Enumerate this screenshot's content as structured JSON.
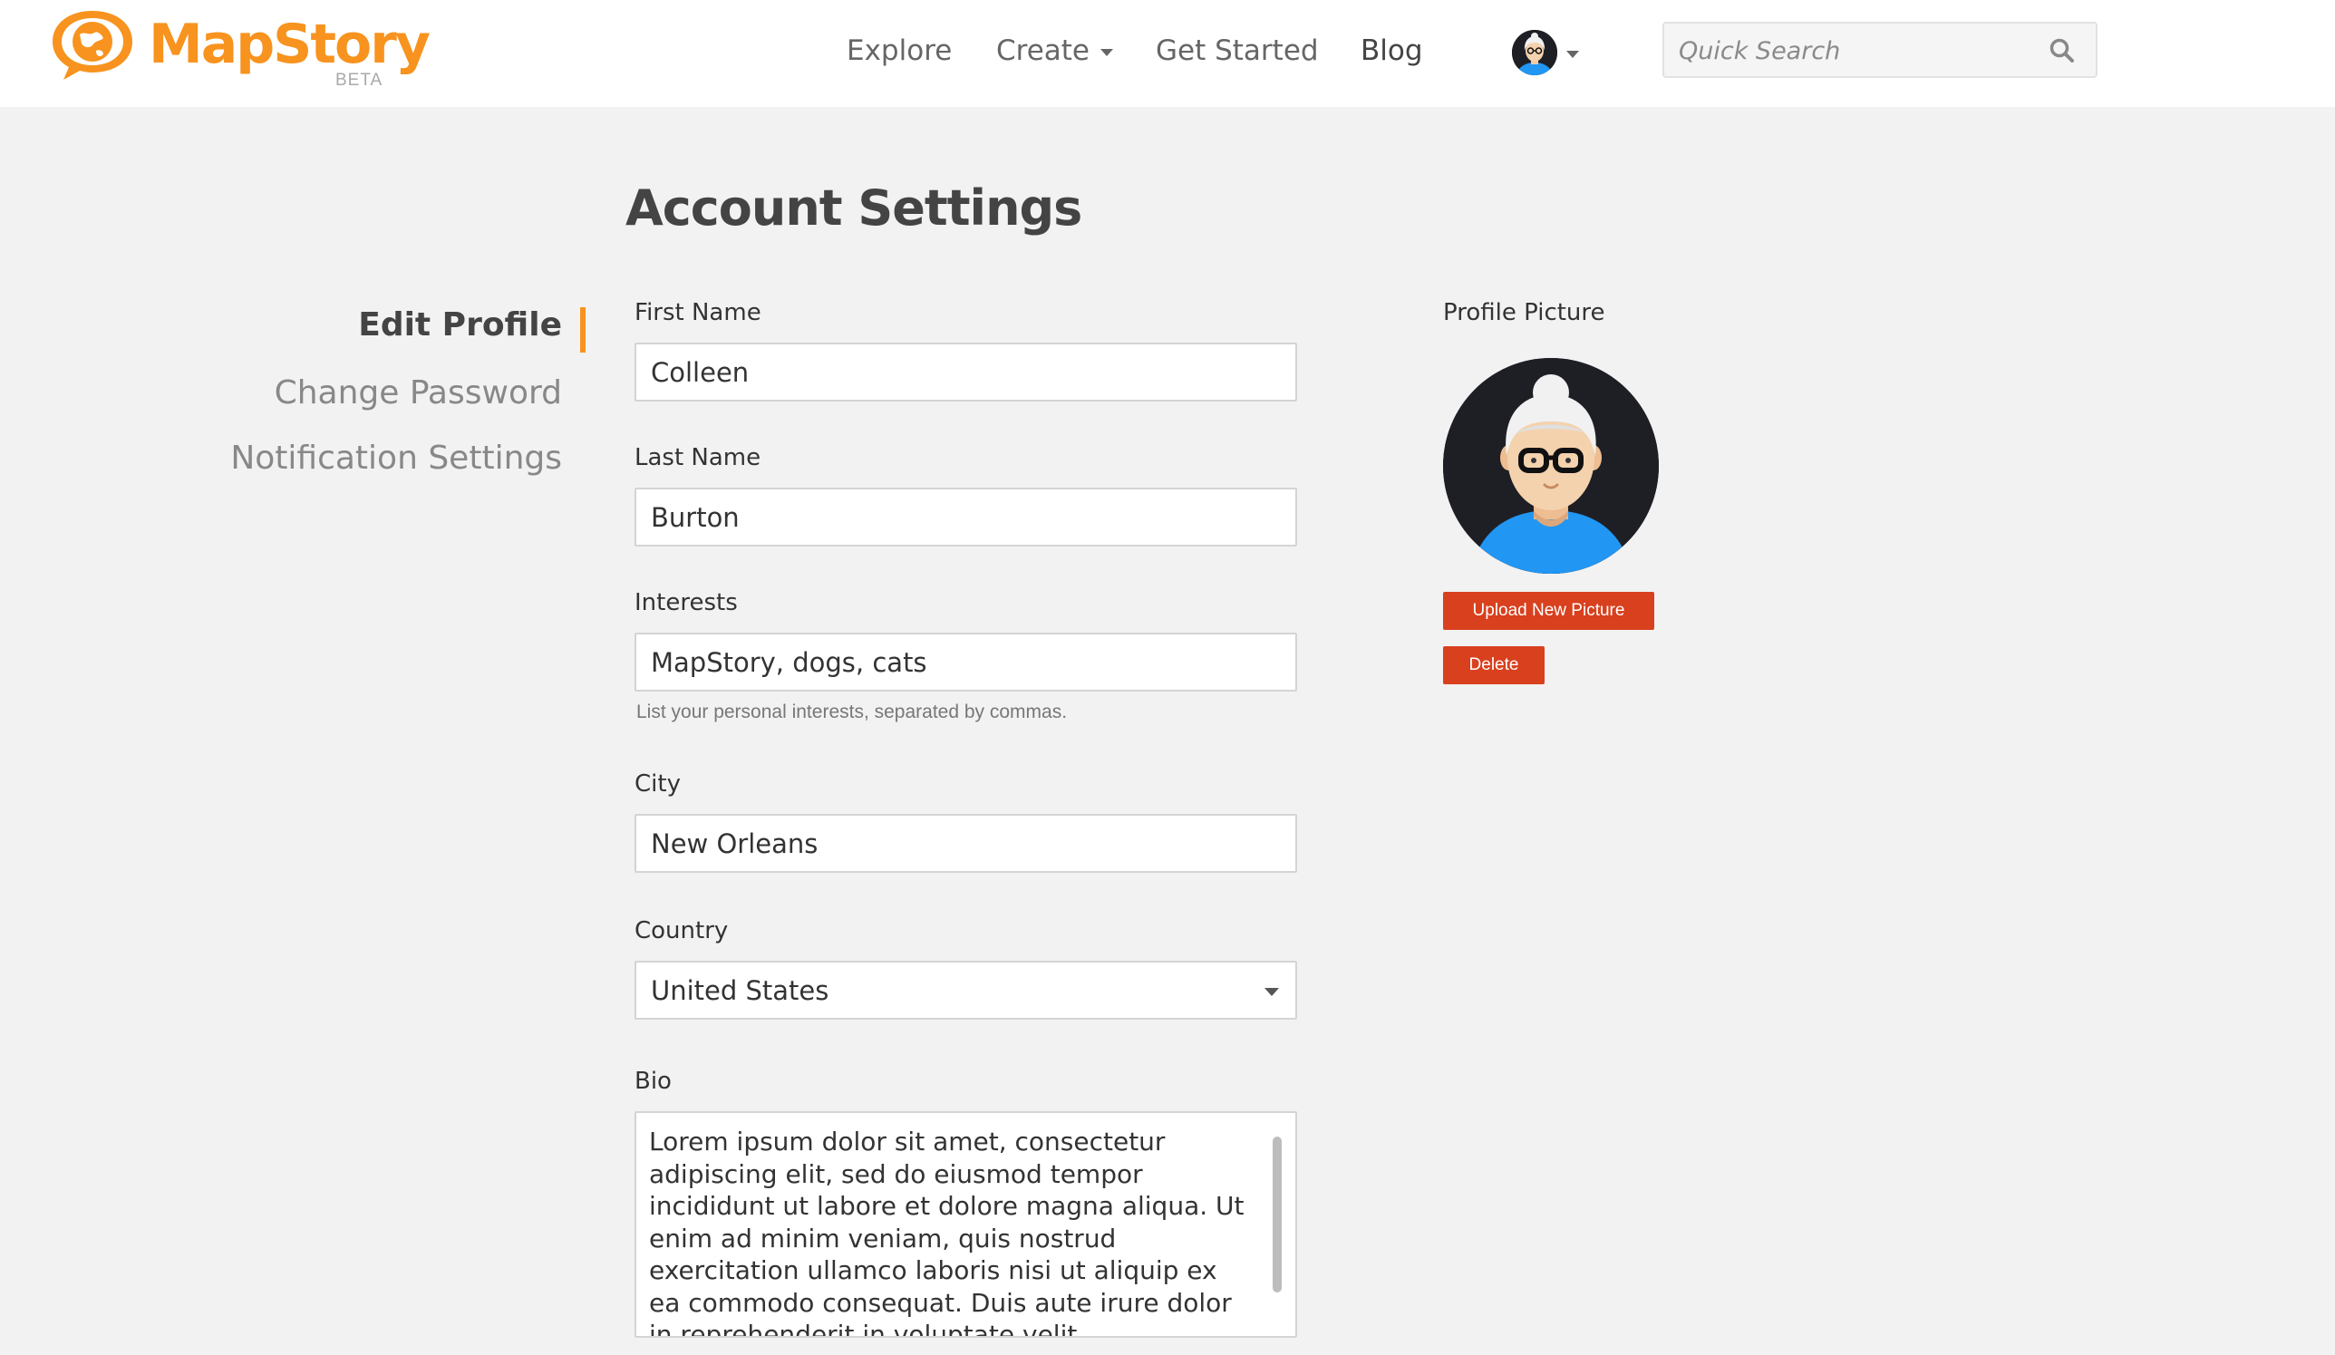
{
  "header": {
    "logo_text": "MapStory",
    "logo_badge": "BETA",
    "nav": {
      "explore": "Explore",
      "create": "Create",
      "get_started": "Get Started",
      "blog": "Blog"
    },
    "search_placeholder": "Quick Search",
    "icons": [
      "globe-chat-logo-icon",
      "user-avatar-icon",
      "caret-down-icon",
      "search-icon"
    ]
  },
  "page": {
    "title": "Account Settings"
  },
  "side_nav": {
    "items": [
      {
        "label": "Edit Profile",
        "active": true
      },
      {
        "label": "Change Password",
        "active": false
      },
      {
        "label": "Notification Settings",
        "active": false
      }
    ]
  },
  "form": {
    "first_name": {
      "label": "First Name",
      "value": "Colleen"
    },
    "last_name": {
      "label": "Last Name",
      "value": "Burton"
    },
    "interests": {
      "label": "Interests",
      "value": "MapStory, dogs, cats",
      "help": "List your personal interests, separated by commas."
    },
    "city": {
      "label": "City",
      "value": "New Orleans"
    },
    "country": {
      "label": "Country",
      "value": "United States"
    },
    "bio": {
      "label": "Bio",
      "value": "Lorem ipsum dolor sit amet, consectetur adipiscing elit, sed do eiusmod tempor incididunt ut labore et dolore magna aliqua. Ut enim ad minim veniam, quis nostrud exercitation ullamco laboris nisi ut aliquip ex ea commodo consequat. Duis aute irure dolor in reprehenderit in voluptate velit"
    }
  },
  "profile_picture": {
    "label": "Profile Picture",
    "upload_label": "Upload New Picture",
    "delete_label": "Delete"
  },
  "colors": {
    "brand_orange": "#f7931e",
    "button_red": "#d8401e",
    "page_background": "#f2f2f2",
    "avatar_shirt": "#2196f3"
  }
}
